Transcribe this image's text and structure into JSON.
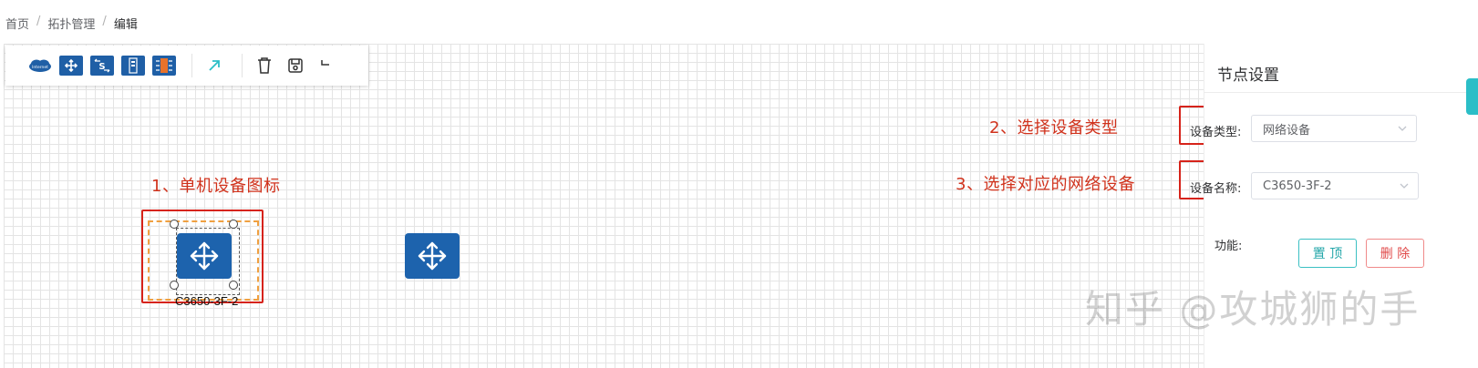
{
  "breadcrumb": {
    "home": "首页",
    "sep": "/",
    "topology": "拓扑管理",
    "current": "编辑"
  },
  "toolbar": {
    "icons": [
      "internet-cloud-icon",
      "switch-icon",
      "s-switch-icon",
      "server-icon",
      "rack-icon",
      "link-arrow-icon",
      "trash-icon",
      "save-icon",
      "undo-icon"
    ],
    "cloud_text": "Internet"
  },
  "annotations": {
    "step1": "1、单机设备图标",
    "step2": "2、选择设备类型",
    "step3": "3、选择对应的网络设备"
  },
  "canvas": {
    "selected_node_label": "C3650-3F-2"
  },
  "panel": {
    "title": "节点设置",
    "device_type_label": "设备类型:",
    "device_type_value": "网络设备",
    "device_name_label": "设备名称:",
    "device_name_value": "C3650-3F-2",
    "function_label": "功能:",
    "top_button": "置 顶",
    "delete_button": "删 除"
  },
  "watermark": "知乎 @攻城狮的手",
  "colors": {
    "device_blue": "#1d63ad",
    "annotation_red": "#d0321c",
    "accent_teal": "#2bbec7"
  }
}
